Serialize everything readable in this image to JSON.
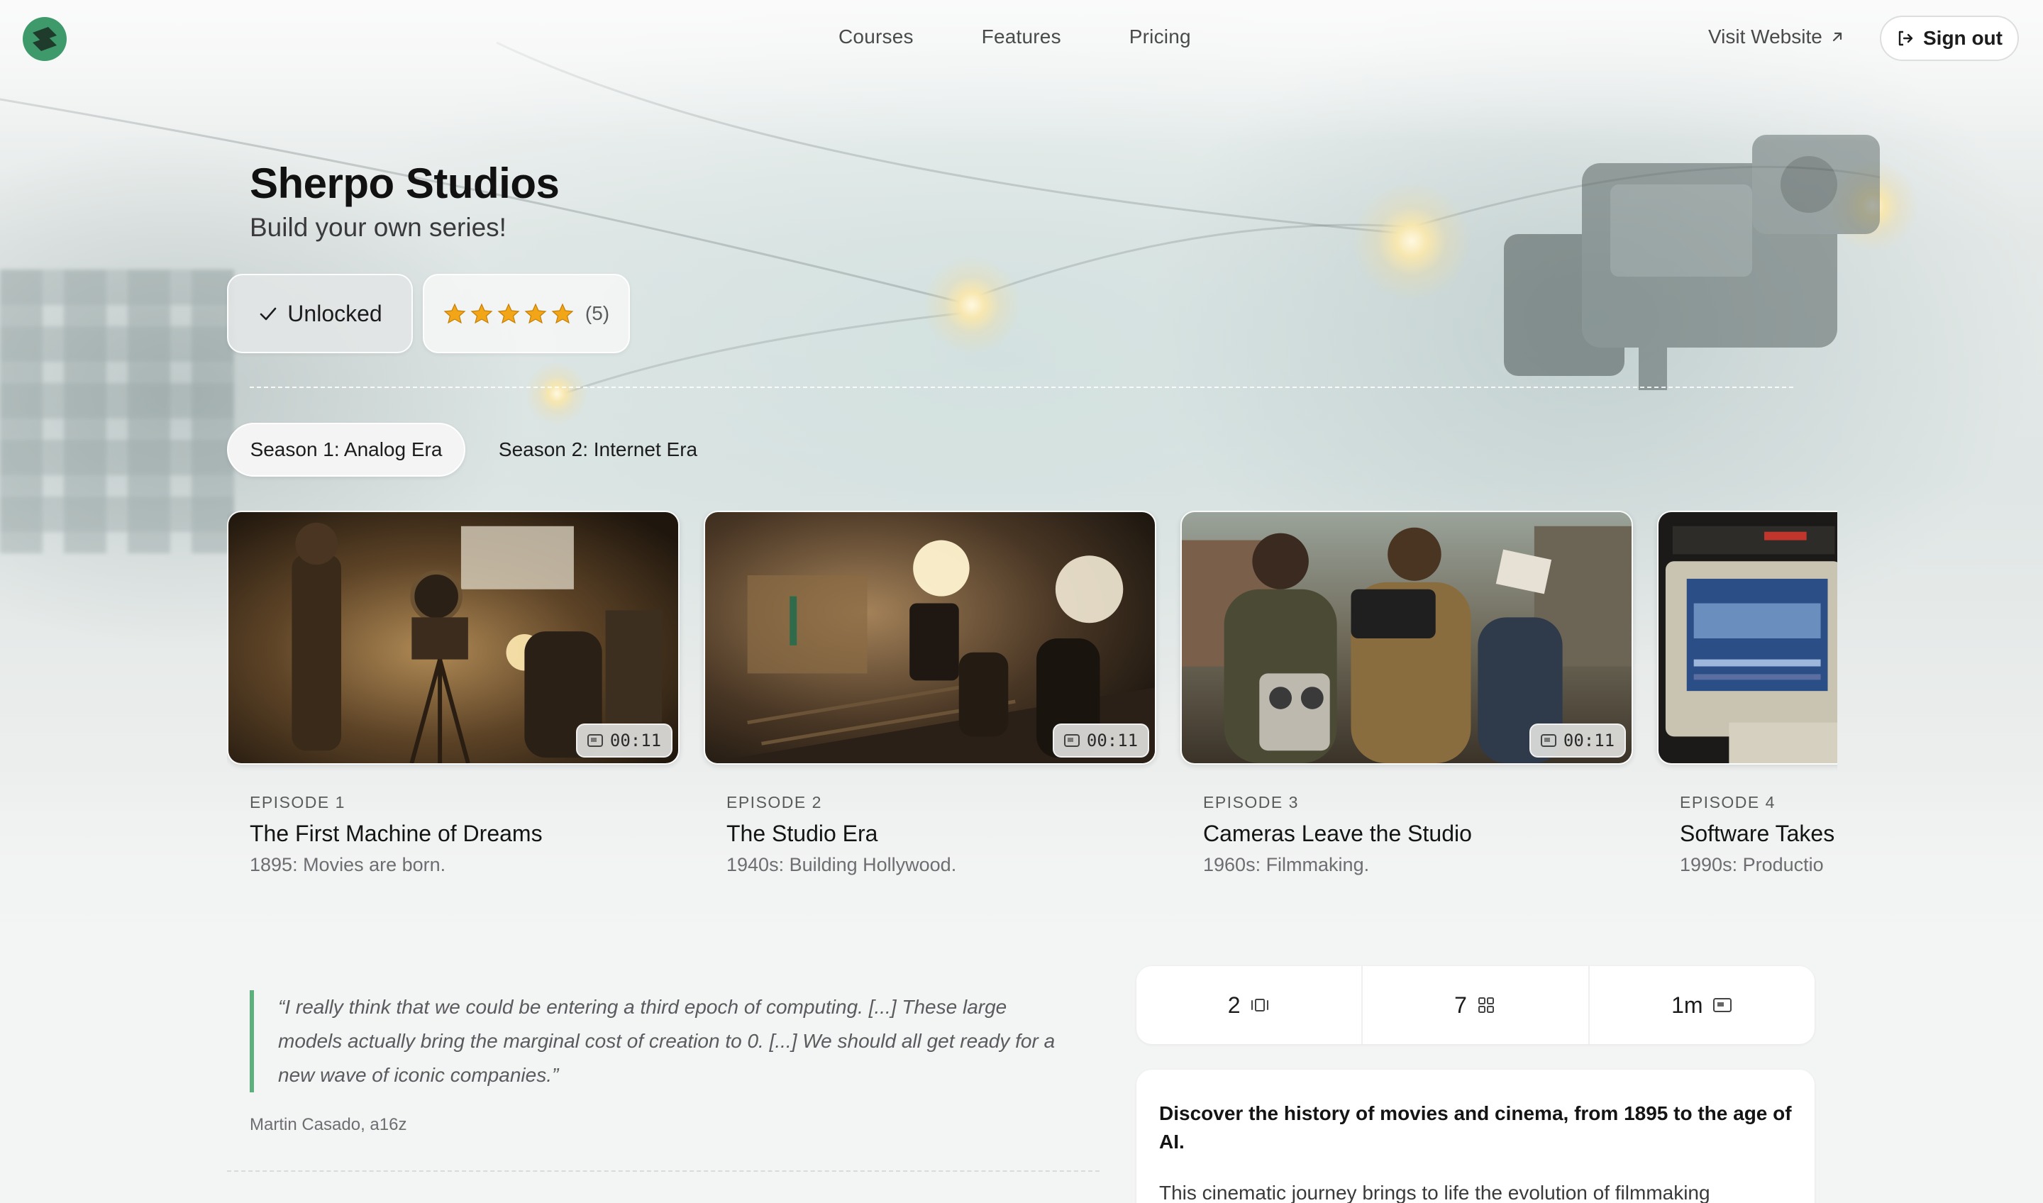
{
  "nav": {
    "logo_alt": "Sherpo logo",
    "links": [
      "Courses",
      "Features",
      "Pricing"
    ],
    "visit_label": "Visit Website",
    "signout_label": "Sign out"
  },
  "course": {
    "title": "Sherpo Studios",
    "subtitle": "Build your own series!",
    "unlocked_label": "Unlocked",
    "rating": {
      "stars": 5,
      "max": 5,
      "count_label": "(5)"
    }
  },
  "seasons": [
    {
      "label": "Season 1: Analog Era",
      "active": true
    },
    {
      "label": "Season 2: Internet Era",
      "active": false
    }
  ],
  "episodes": [
    {
      "number": "EPISODE 1",
      "title": "The First Machine of Dreams",
      "description": "1895: Movies are born.",
      "duration": "00:11"
    },
    {
      "number": "EPISODE 2",
      "title": "The Studio Era",
      "description": "1940s: Building Hollywood.",
      "duration": "00:11"
    },
    {
      "number": "EPISODE 3",
      "title": "Cameras Leave the Studio",
      "description": "1960s: Filmmaking.",
      "duration": "00:11"
    },
    {
      "number": "EPISODE 4",
      "title": "Software Takes",
      "description": "1990s: Productio",
      "duration": ""
    }
  ],
  "quote": {
    "text": "“I really think that we could be entering a third epoch of computing. [...] These large models actually bring the marginal cost of creation to 0. [...] We should all get ready for a new wave of iconic companies.”",
    "author": "Martin Casado, a16z"
  },
  "stats": [
    {
      "value": "2",
      "icon": "seasons-icon"
    },
    {
      "value": "7",
      "icon": "episodes-grid-icon"
    },
    {
      "value": "1m",
      "icon": "duration-icon"
    }
  ],
  "description": {
    "heading": "Discover the history of movies and cinema, from 1895 to the age of AI.",
    "body": "This cinematic journey brings to life the evolution of filmmaking"
  },
  "colors": {
    "accent_green": "#5fae7d",
    "logo_green": "#3f9a6b",
    "star_orange": "#f2a516"
  }
}
